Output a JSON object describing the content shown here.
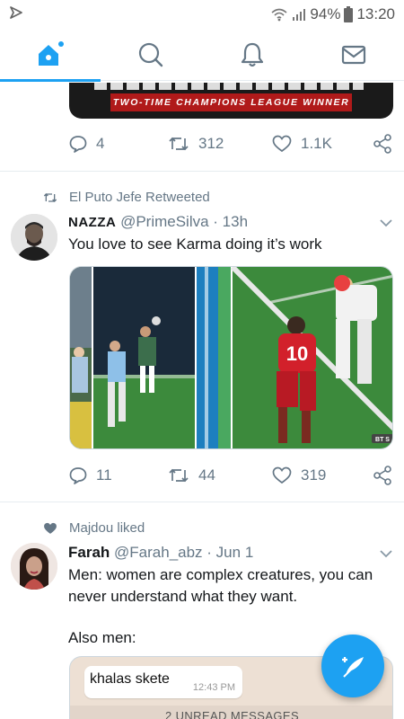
{
  "status_bar": {
    "battery": "94%",
    "time": "13:20"
  },
  "nav": {
    "tabs": [
      {
        "icon": "home-icon",
        "active": true
      },
      {
        "icon": "search-icon"
      },
      {
        "icon": "bell-icon"
      },
      {
        "icon": "mail-icon"
      }
    ]
  },
  "tweet1": {
    "banner_text": "TWO-TIME CHAMPIONS LEAGUE WINNER",
    "replies": "4",
    "retweets": "312",
    "likes": "1.1K"
  },
  "tweet2": {
    "context": "El Puto Jefe Retweeted",
    "name": "NAZZA",
    "handle": "@PrimeSilva",
    "time": "· 13h",
    "text": "You love to see Karma doing it’s work",
    "jersey_number": "10",
    "tv_badge": "BT S",
    "replies": "11",
    "retweets": "44",
    "likes": "319"
  },
  "tweet3": {
    "context": "Majdou liked",
    "name": "Farah",
    "handle": "@Farah_abz",
    "time": "· Jun 1",
    "text_line1": "Men: women are complex creatures, you can",
    "text_line2": "never understand what they want.",
    "text_line3": "Also men:",
    "chat_message": "khalas skete",
    "chat_time": "12:43 PM",
    "unread_label": "2 UNREAD MESSAGES"
  },
  "colors": {
    "accent": "#1da1f2",
    "muted": "#657786",
    "divider": "#e6ecf0",
    "pitch": "#3c8a3c",
    "liverpool": "#d2202b"
  }
}
